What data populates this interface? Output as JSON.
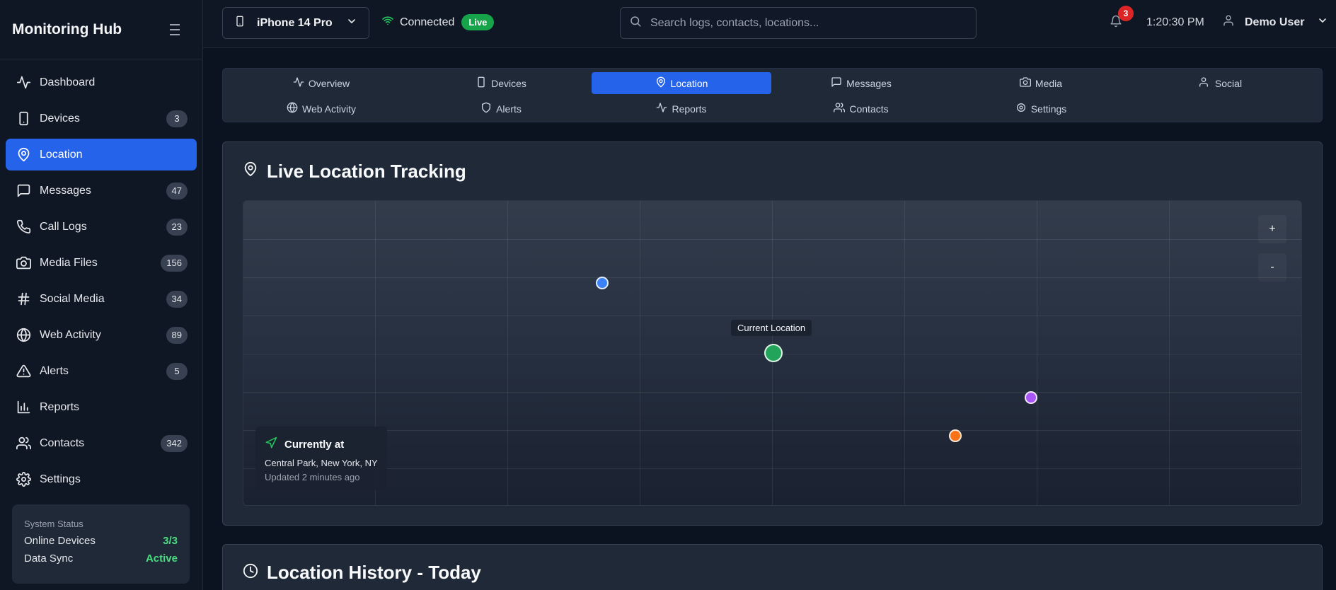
{
  "sidebar": {
    "title": "Monitoring Hub",
    "items": [
      {
        "label": "Dashboard",
        "badge": ""
      },
      {
        "label": "Devices",
        "badge": "3"
      },
      {
        "label": "Location",
        "badge": ""
      },
      {
        "label": "Messages",
        "badge": "47"
      },
      {
        "label": "Call Logs",
        "badge": "23"
      },
      {
        "label": "Media Files",
        "badge": "156"
      },
      {
        "label": "Social Media",
        "badge": "34"
      },
      {
        "label": "Web Activity",
        "badge": "89"
      },
      {
        "label": "Alerts",
        "badge": "5"
      },
      {
        "label": "Reports",
        "badge": ""
      },
      {
        "label": "Contacts",
        "badge": "342"
      },
      {
        "label": "Settings",
        "badge": ""
      }
    ],
    "status": {
      "label": "System Status",
      "online_label": "Online Devices",
      "online_value": "3/3",
      "sync_label": "Data Sync",
      "sync_value": "Active"
    }
  },
  "topbar": {
    "device": "iPhone 14 Pro",
    "connection": "Connected",
    "live": "Live",
    "search_placeholder": "Search logs, contacts, locations...",
    "notifications": "3",
    "time": "1:20:30 PM",
    "user": "Demo User"
  },
  "tabs": [
    {
      "label": "Overview"
    },
    {
      "label": "Devices"
    },
    {
      "label": "Location"
    },
    {
      "label": "Messages"
    },
    {
      "label": "Media"
    },
    {
      "label": "Social"
    },
    {
      "label": "Web Activity"
    },
    {
      "label": "Alerts"
    },
    {
      "label": "Reports"
    },
    {
      "label": "Contacts"
    },
    {
      "label": "Settings"
    }
  ],
  "map_card": {
    "title": "Live Location Tracking",
    "zoom_in": "+",
    "zoom_out": "-",
    "current_tooltip": "Current Location",
    "current": {
      "heading": "Currently at",
      "address": "Central Park, New York, NY",
      "updated": "Updated 2 minutes ago"
    },
    "marker_colors": {
      "current": "#22a55a",
      "blue": "#3b82f6",
      "purple": "#a855f7",
      "orange": "#f97316"
    }
  },
  "history_card": {
    "title": "Location History - Today"
  },
  "colors": {
    "accent": "#2563eb",
    "live": "#16a34a",
    "alert": "#dc2626"
  }
}
